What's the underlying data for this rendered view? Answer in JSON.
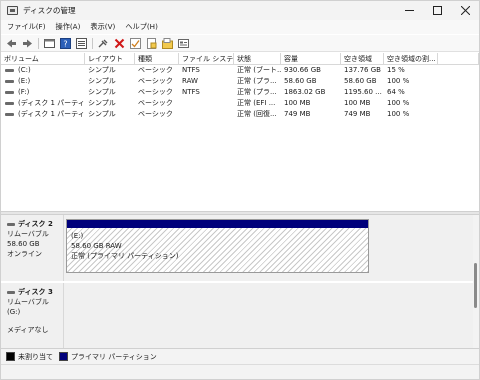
{
  "window": {
    "title": "ディスクの管理"
  },
  "menu": [
    "ファイル(F)",
    "操作(A)",
    "表示(V)",
    "ヘルプ(H)"
  ],
  "toolbar": [
    "back-icon",
    "forward-icon",
    "properties-icon",
    "help-icon",
    "connect-icon",
    "delete-icon",
    "check-icon",
    "new-volume-icon",
    "open-icon",
    "settings-icon"
  ],
  "volume_table": {
    "headers": [
      "ボリューム",
      "レイアウト",
      "種類",
      "ファイル システム",
      "状態",
      "容量",
      "空き領域",
      "空き領域の割...",
      ""
    ],
    "rows": [
      [
        "(C:)",
        "シンプル",
        "ベーシック",
        "NTFS",
        "正常 (ブート...",
        "930.66 GB",
        "137.76 GB",
        "15 %"
      ],
      [
        "(E:)",
        "シンプル",
        "ベーシック",
        "RAW",
        "正常 (プラ...",
        "58.60 GB",
        "58.60 GB",
        "100 %"
      ],
      [
        "(F:)",
        "シンプル",
        "ベーシック",
        "NTFS",
        "正常 (プラ...",
        "1863.02 GB",
        "1195.60 ...",
        "64 %"
      ],
      [
        "(ディスク 1 パーティシ...",
        "シンプル",
        "ベーシック",
        "",
        "正常 (EFI ...",
        "100 MB",
        "100 MB",
        "100 %"
      ],
      [
        "(ディスク 1 パーティシ...",
        "シンプル",
        "ベーシック",
        "",
        "正常 (回復...",
        "749 MB",
        "749 MB",
        "100 %"
      ]
    ]
  },
  "disks": [
    {
      "name": "ディスク 2",
      "type": "リムーバブル",
      "size": "58.60 GB",
      "status": "オンライン",
      "partition": {
        "letter": "(E:)",
        "size_fs": "58.60 GB RAW",
        "state": "正常 (プライマリ パーティション)"
      }
    },
    {
      "name": "ディスク 3",
      "type": "リムーバブル (G:)",
      "status": "メディアなし"
    }
  ],
  "legend": [
    {
      "label": "未割り当て",
      "color": "#000000"
    },
    {
      "label": "プライマリ パーティション",
      "color": "#00007b"
    }
  ],
  "colors": {
    "primary_partition": "#00007b",
    "unallocated": "#000000"
  }
}
